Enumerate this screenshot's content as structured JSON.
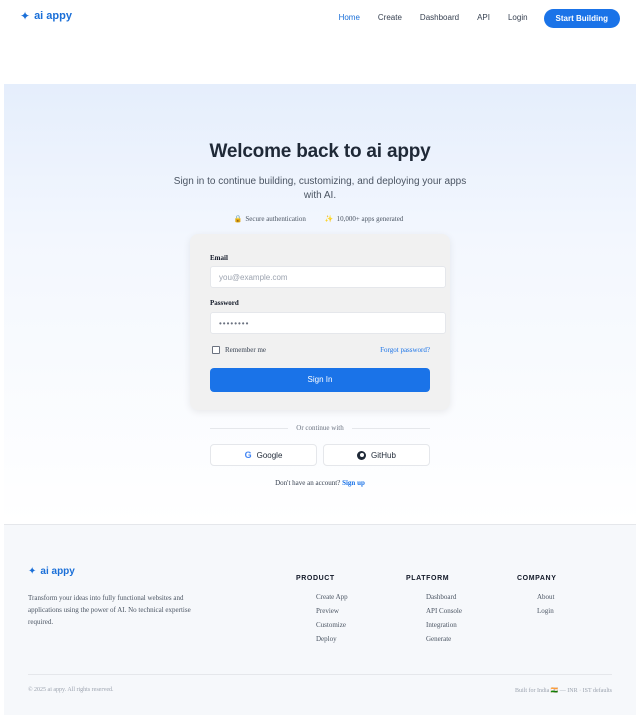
{
  "brand": {
    "name": "ai appy",
    "icon": "sparkle-icon",
    "accent": "#1a73e8"
  },
  "nav": {
    "links": [
      "Home",
      "Create",
      "Dashboard",
      "API",
      "Login"
    ],
    "cta": "Start Building"
  },
  "hero": {
    "title": "Welcome back to ai appy",
    "subtitle": "Sign in to continue building, customizing, and deploying your apps with AI.",
    "badges": [
      {
        "icon": "🔒",
        "text": "Secure authentication"
      },
      {
        "icon": "✨",
        "text": "10,000+ apps generated"
      }
    ]
  },
  "form": {
    "email_label": "Email",
    "email_placeholder": "you@example.com",
    "password_label": "Password",
    "password_value": "••••••••",
    "remember": "Remember me",
    "forgot": "Forgot password?",
    "submit": "Sign In",
    "divider": "Or continue with",
    "google": "Google",
    "github": "GitHub",
    "signup_prompt": "Don't have an account?",
    "signup_link": "Sign up"
  },
  "footer": {
    "brand": "ai appy",
    "description": "Transform your ideas into fully functional websites and applications using the power of AI. No technical expertise required.",
    "columns": [
      {
        "title": "PRODUCT",
        "items": [
          "Create App",
          "Preview",
          "Customize",
          "Deploy"
        ]
      },
      {
        "title": "PLATFORM",
        "items": [
          "Dashboard",
          "API Console",
          "Integration",
          "Generate"
        ]
      },
      {
        "title": "COMPANY",
        "items": [
          "About",
          "Login"
        ]
      }
    ],
    "copyright": "© 2025 ai appy. All rights reserved.",
    "built": "Built for India 🇮🇳 — INR · IST defaults"
  }
}
